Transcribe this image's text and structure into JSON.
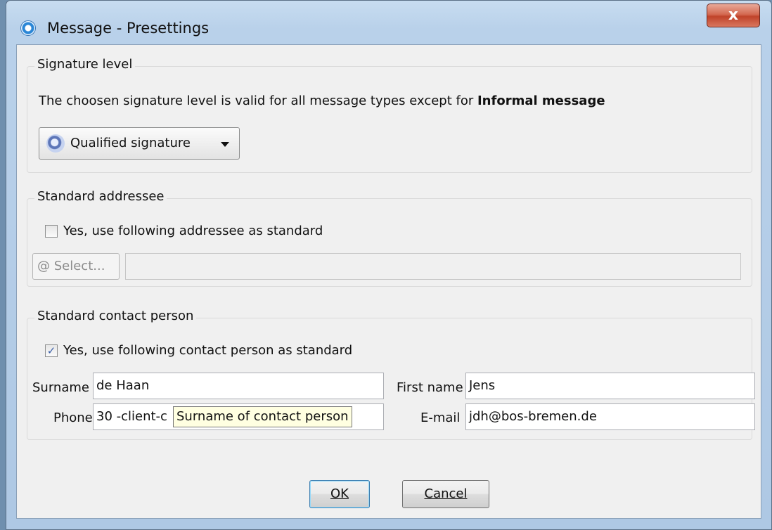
{
  "window": {
    "title": "Message - Presettings",
    "close_label": "x"
  },
  "signature": {
    "legend": "Signature level",
    "info_prefix": "The choosen signature level is valid for all message types except for ",
    "info_bold": "Informal message",
    "selected": "Qualified signature",
    "icon": "signature-seal-icon"
  },
  "addressee": {
    "legend": "Standard addressee",
    "checkbox_label": "Yes, use following addressee as standard",
    "checked": false,
    "select_label": "@ Select...",
    "value": ""
  },
  "contact": {
    "legend": "Standard contact person",
    "checkbox_label": "Yes, use following contact person as standard",
    "checked": true,
    "surname_label": "Surname",
    "surname_value": "de Haan",
    "firstname_label": "First name",
    "firstname_value": "Jens",
    "phone_label": "Phone",
    "phone_value": "30 -client-c",
    "email_label": "E-mail",
    "email_value": "jdh@bos-bremen.de",
    "tooltip": "Surname of contact person"
  },
  "buttons": {
    "ok_label": "OK",
    "cancel_label": "Cancel"
  },
  "colors": {
    "close_button": "#c0432a",
    "tooltip_bg": "#ffffe1",
    "checkbox_check": "#3a5ea8"
  }
}
